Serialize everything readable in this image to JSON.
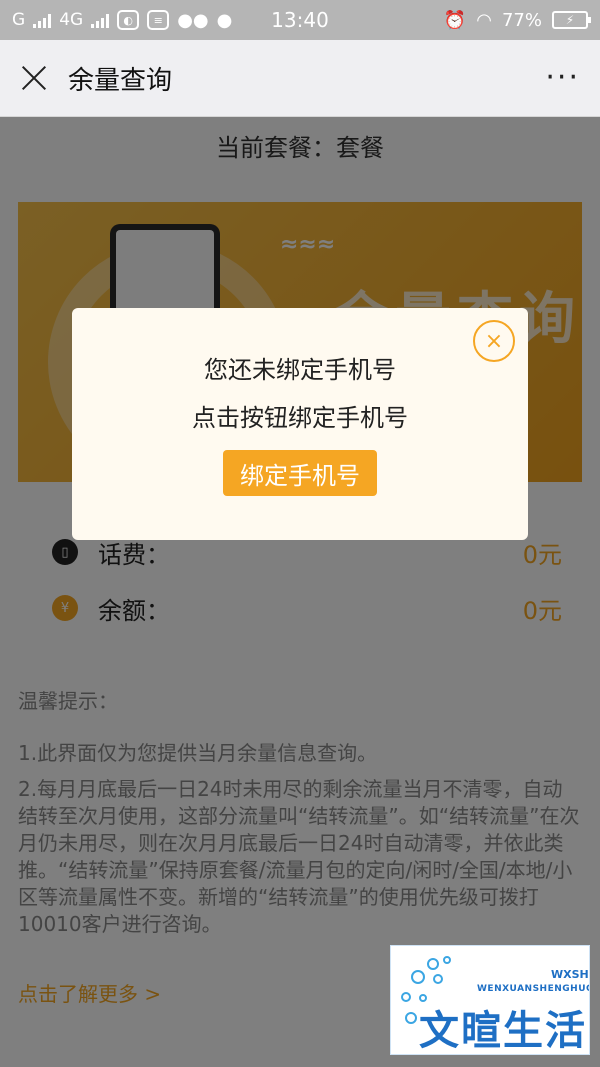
{
  "status_bar": {
    "left_items": [
      "G",
      "4G"
    ],
    "time": "13:40",
    "battery_percent": "77%"
  },
  "nav": {
    "title": "余量查询",
    "more": "···"
  },
  "plan": {
    "text": "当前套餐：套餐"
  },
  "banner": {
    "text": "余量查询",
    "wave": "≈≈≈"
  },
  "balances": [
    {
      "label": "话费：",
      "value": "0元",
      "icon": "phone-bill-icon",
      "icon_color": "#222222"
    },
    {
      "label": "余额：",
      "value": "0元",
      "icon": "money-bag-icon",
      "icon_color": "#f5a623"
    }
  ],
  "tips": {
    "title": "温馨提示：",
    "items": [
      "1.此界面仅为您提供当月余量信息查询。",
      "2.每月月底最后一日24时未用尽的剩余流量当月不清零，自动结转至次月使用，这部分流量叫“结转流量”。如“结转流量”在次月仍未用尽，则在次月月底最后一日24时自动清零，并依此类推。“结转流量”保持原套餐/流量月包的定向/闲时/全国/本地/小区等流量属性不变。新增的“结转流量”的使用优先级可拨打10010客户进行咨询。"
    ],
    "more_link": "点击了解更多 >"
  },
  "modal": {
    "line1": "您还未绑定手机号",
    "line2": "点击按钮绑定手机号",
    "button": "绑定手机号",
    "close": "×"
  },
  "watermark": {
    "tag": "WXSH",
    "sub": "WENXUANSHENGHUO",
    "main": "文暄生活"
  },
  "colors": {
    "accent": "#f5a623",
    "overlay": "rgba(0,0,0,0.5)",
    "modal_bg": "#fffaf0"
  }
}
